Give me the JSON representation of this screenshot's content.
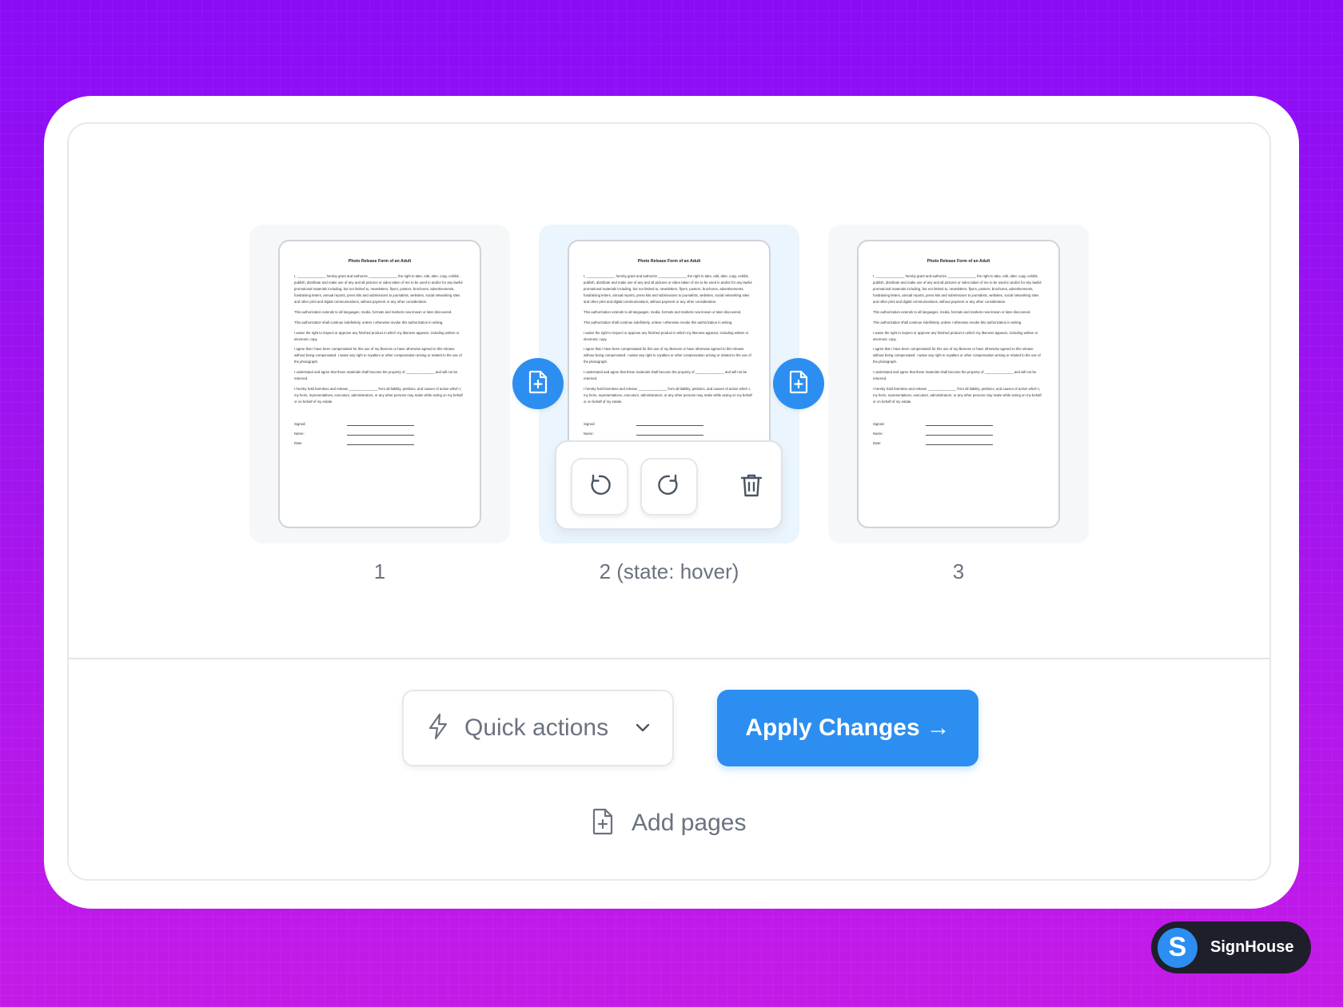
{
  "document": {
    "title": "Photo Release Form of an Adult",
    "paragraphs": [
      "I, _______________ hereby grant and authorize _______________ the right to take, edit, alter, copy, exhibit, publish, distribute and make use of any and all pictures or video taken of me to be used in and/or for any lawful promotional materials including, but not limited to, newsletters, flyers, posters, brochures, advertisements, fundraising letters, annual reports, press kits and submissions to journalists, websites, social networking sites and other print and digital communications, without payment or any other consideration.",
      "This authorization extends to all languages, media, formats and markets now known or later discovered.",
      "This authorization shall continue indefinitely, unless I otherwise revoke this authorization in writing.",
      "I waive the right to inspect or approve any finished product in which my likeness appears, including written or electronic copy.",
      "I agree that I have been compensated for this use of my likeness or have otherwise agreed to this release without being compensated. I waive any right to royalties or other compensation arising or related to the use of the photograph.",
      "I understand and agree that these materials shall become the property of _______________ and will not be returned.",
      "I hereby hold harmless and release _______________ from all liability, petitions, and causes of action which I, my heirs, representatives, executors, administrators, or any other persons may make while acting on my behalf or on behalf of my estate."
    ],
    "signature_fields": [
      "Signed:",
      "Name:",
      "Date:"
    ]
  },
  "pages": [
    {
      "label": "1",
      "state": "default"
    },
    {
      "label": "2 (state: hover)",
      "state": "hover"
    },
    {
      "label": "3",
      "state": "default"
    }
  ],
  "page_actions": {
    "rotate_left": "rotate-counterclockwise-icon",
    "rotate_right": "rotate-clockwise-icon",
    "delete": "trash-icon"
  },
  "toolbar": {
    "quick_actions_label": "Quick actions",
    "apply_label": "Apply Changes",
    "apply_arrow": "→",
    "add_pages_label": "Add pages"
  },
  "brand": {
    "logo_letter": "S",
    "name": "SignHouse"
  },
  "colors": {
    "accent": "#2c8ef0",
    "hover_tile": "#eaf5fd",
    "background_top": "#8a0cf7",
    "background_bottom": "#c51ae8"
  }
}
